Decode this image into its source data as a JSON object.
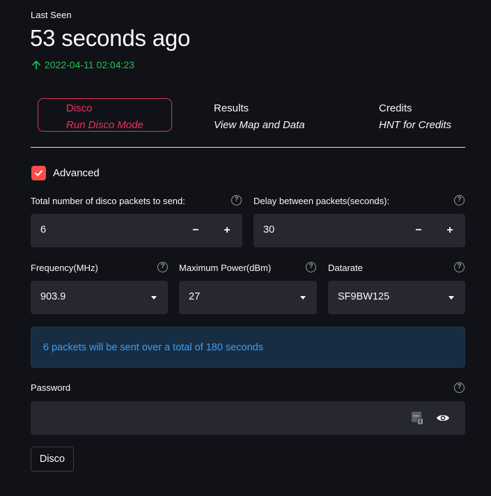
{
  "metric": {
    "label": "Last Seen",
    "value": "53 seconds ago",
    "delta": "2022-04-11 02:04:23",
    "delta_color": "#21c354",
    "delta_icon": "arrow-up-icon"
  },
  "menu": {
    "items": [
      {
        "title": "Disco",
        "subtitle": "Run Disco Mode",
        "active": true
      },
      {
        "title": "Results",
        "subtitle": "View Map and Data",
        "active": false
      },
      {
        "title": "Credits",
        "subtitle": "HNT for Credits",
        "active": false
      }
    ],
    "accent_color": "#e8335a"
  },
  "advanced": {
    "label": "Advanced",
    "checked": true,
    "color": "#ff4b4b"
  },
  "packets": {
    "label": "Total number of disco packets to send:",
    "value": "6",
    "minus": "−",
    "plus": "+"
  },
  "delay": {
    "label": "Delay between packets(seconds):",
    "value": "30",
    "minus": "−",
    "plus": "+"
  },
  "frequency": {
    "label": "Frequency(MHz)",
    "value": "903.9"
  },
  "power": {
    "label": "Maximum Power(dBm)",
    "value": "27"
  },
  "datarate": {
    "label": "Datarate",
    "value": "SF9BW125"
  },
  "info": {
    "message": "6 packets will be sent over a total of 180 seconds",
    "color": "#3d9df3"
  },
  "password": {
    "label": "Password",
    "value": "",
    "icons": [
      "password-manager-icon",
      "eye-icon"
    ]
  },
  "help_icon": "?",
  "submit": {
    "label": "Disco"
  }
}
